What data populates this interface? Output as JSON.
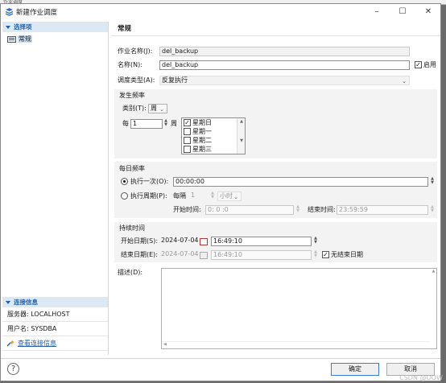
{
  "bg_window_title": "作业调度",
  "window": {
    "title": "新建作业调度",
    "minimize": "–",
    "maximize": "☐",
    "close": "✕"
  },
  "sidebar": {
    "select_header": "选择项",
    "tree_item": "常规",
    "conn_header": "连接信息",
    "server": "服务器: LOCALHOST",
    "user": "用户名: SYSDBA",
    "view_conn": "查看连接信息"
  },
  "main": {
    "header": "常规",
    "job_name_label": "作业名称(J):",
    "job_name_value": "del_backup",
    "name_label": "名称(N):",
    "name_value": "del_backup",
    "enable_label": "启用",
    "enable_checked": true,
    "sched_type_label": "调度类型(A):",
    "sched_type_value": "反复执行",
    "freq": {
      "title": "发生频率",
      "type_label": "类别(T):",
      "type_value": "周",
      "every_label": "每",
      "every_value": "1",
      "unit": "周",
      "days": [
        {
          "label": "星期日",
          "checked": true
        },
        {
          "label": "星期一",
          "checked": false
        },
        {
          "label": "星期二",
          "checked": false
        },
        {
          "label": "星期三",
          "checked": false
        }
      ]
    },
    "daily": {
      "title": "每日频率",
      "once_label": "执行一次(O):",
      "once_value": "00:00:00",
      "period_label": "执行周期(P):",
      "every_label": "每隔",
      "every_value": "1",
      "unit_value": "小时",
      "start_label": "开始时间:",
      "start_value": "0: 0 :0",
      "end_label": "结束时间:",
      "end_value": "23:59:59"
    },
    "duration": {
      "title": "持续时间",
      "start_date_label": "开始日期(S):",
      "start_date_value": "2024-07-04",
      "start_time_value": "16:49:10",
      "end_date_label": "结束日期(E):",
      "end_date_value": "2024-07-04",
      "end_time_value": "16:49:10",
      "no_end_label": "无结束日期",
      "no_end_checked": true
    },
    "desc_label": "描述(D):"
  },
  "footer": {
    "help": "?",
    "ok": "确定",
    "cancel": "取消"
  },
  "watermark": "CSDN @OOW"
}
